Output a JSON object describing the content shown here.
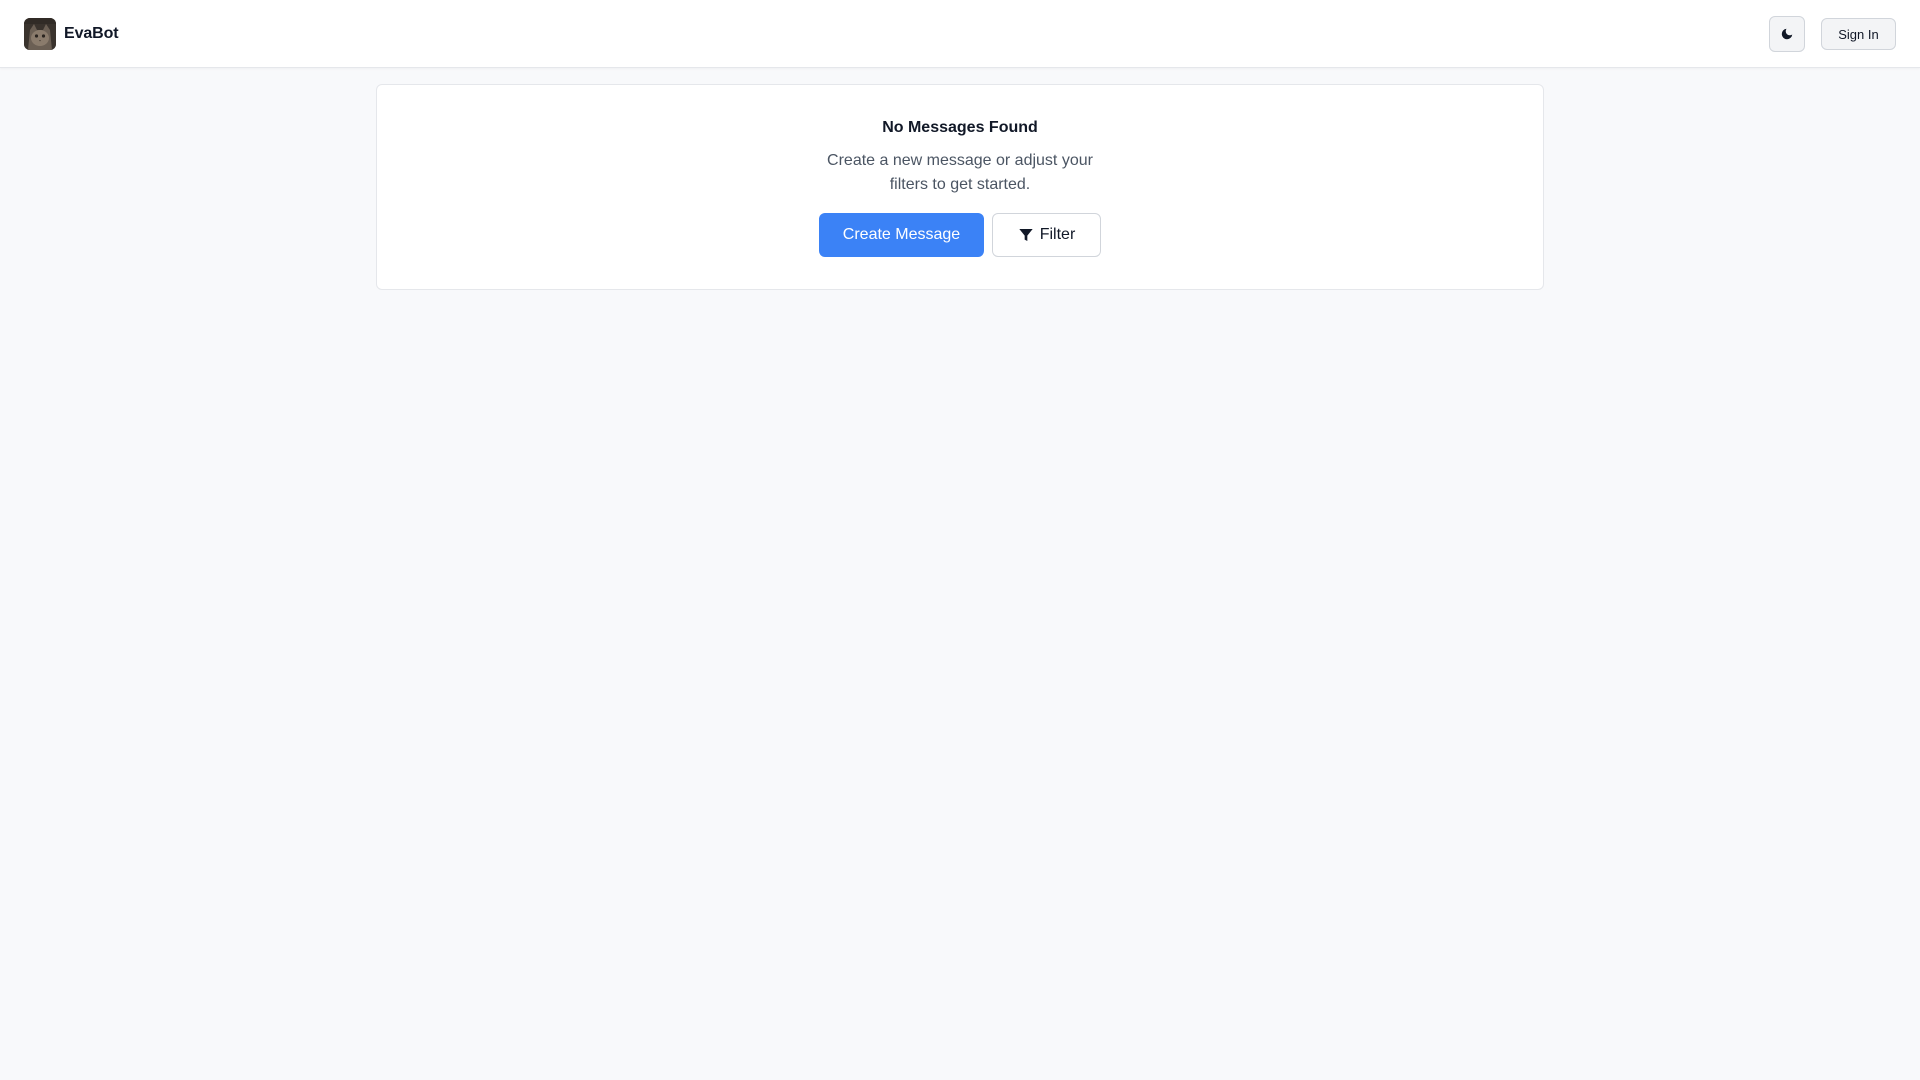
{
  "app": {
    "name": "EvaBot",
    "avatar_icon": "cat-avatar"
  },
  "header": {
    "theme_toggle_icon": "moon-icon",
    "sign_in_label": "Sign In"
  },
  "empty_state": {
    "title": "No Messages Found",
    "description": "Create a new message or adjust your filters to get started.",
    "create_label": "Create Message",
    "filter_label": "Filter",
    "filter_icon": "funnel-icon"
  },
  "colors": {
    "accent": "#3b82f6",
    "background": "#f8f9fb",
    "surface": "#ffffff",
    "border": "#e5e7eb"
  }
}
